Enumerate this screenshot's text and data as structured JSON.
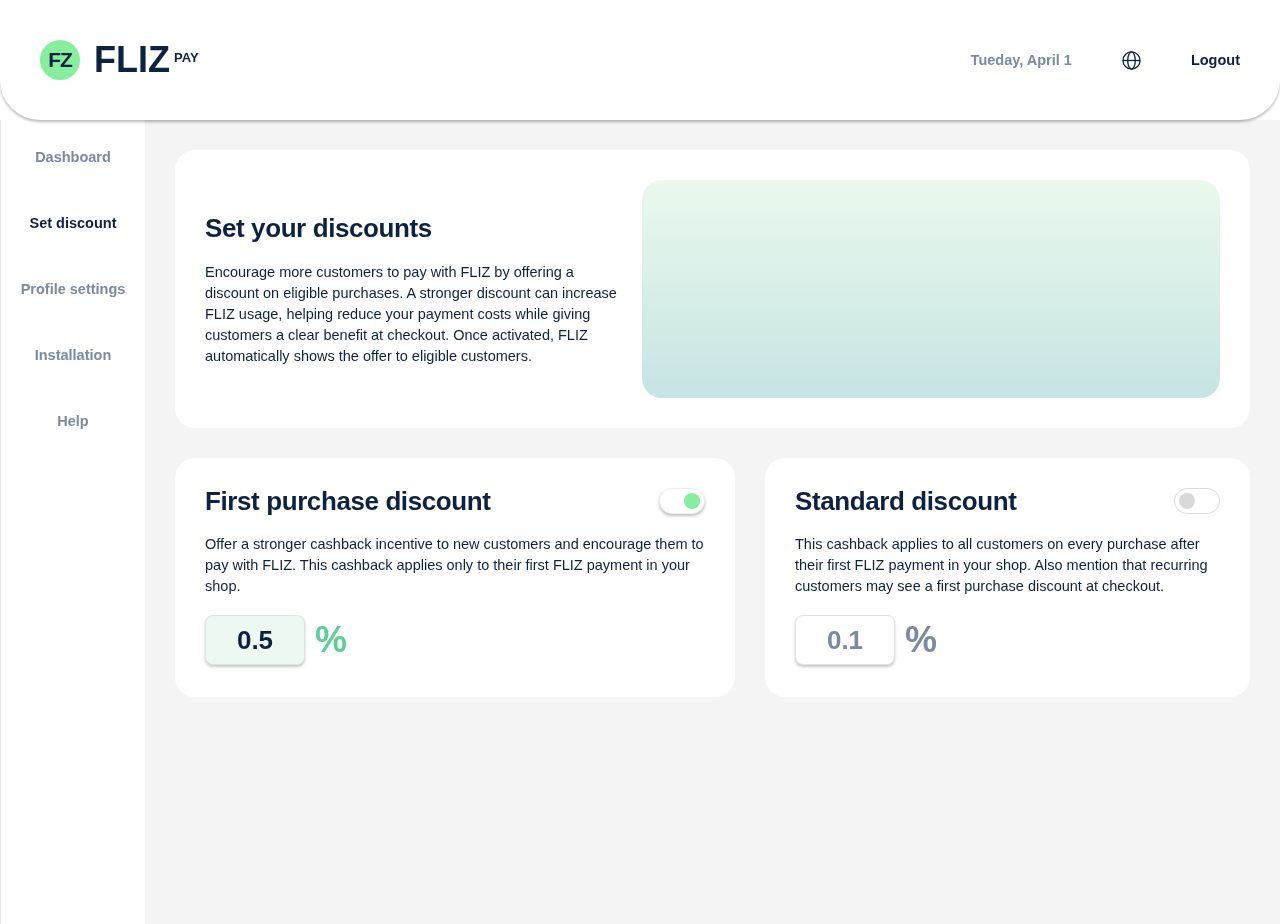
{
  "header": {
    "logo": {
      "mark": "FZ",
      "name": "FLIZ",
      "suffix": "PAY"
    },
    "date": "Tueday, April 1",
    "logout": "Logout"
  },
  "sidebar": {
    "items": [
      {
        "label": "Dashboard",
        "selected": false
      },
      {
        "label": "Set discount",
        "selected": true
      },
      {
        "label": "Profile settings",
        "selected": false
      },
      {
        "label": "Installation",
        "selected": false
      },
      {
        "label": "Help",
        "selected": false
      }
    ]
  },
  "intro": {
    "title": "Set your discounts",
    "text": "Encourage more customers to pay with FLIZ by offering a discount on eligible purchases. A stronger discount can increase FLIZ usage, helping reduce your payment costs while giving customers a clear benefit at checkout. Once activated, FLIZ automatically shows the offer to eligible customers."
  },
  "discounts": [
    {
      "title": "First purchase discount",
      "on": true,
      "text": "Offer a stronger cashback incentive to new customers and encourage them to pay with FLIZ. This cashback applies only to their first FLIZ payment in your shop.",
      "value": "0.5",
      "unit": "%"
    },
    {
      "title": "Standard discount",
      "on": false,
      "text": "This cashback applies to all customers on every purchase after their first FLIZ payment in your shop. Also mention that recurring customers may see a first purchase discount at checkout.",
      "value": "0.1",
      "unit": "%"
    }
  ]
}
